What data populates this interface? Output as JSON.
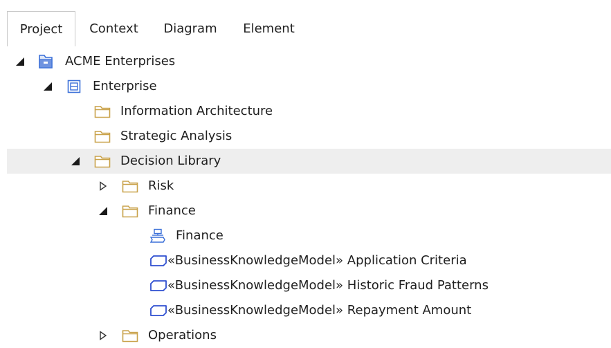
{
  "tabs": [
    {
      "label": "Project",
      "active": true
    },
    {
      "label": "Context",
      "active": false
    },
    {
      "label": "Diagram",
      "active": false
    },
    {
      "label": "Element",
      "active": false
    }
  ],
  "tree": [
    {
      "label": "ACME Enterprises",
      "icon": "root-package-icon",
      "toggle": "expanded"
    },
    {
      "label": "Enterprise",
      "icon": "package-icon",
      "toggle": "expanded"
    },
    {
      "label": "Information Architecture",
      "icon": "folder-icon",
      "toggle": "none"
    },
    {
      "label": "Strategic Analysis",
      "icon": "folder-icon",
      "toggle": "none"
    },
    {
      "label": "Decision Library",
      "icon": "folder-icon",
      "toggle": "expanded",
      "selected": true
    },
    {
      "label": "Risk",
      "icon": "folder-icon",
      "toggle": "collapsed"
    },
    {
      "label": "Finance",
      "icon": "folder-icon",
      "toggle": "expanded"
    },
    {
      "label": "Finance",
      "icon": "diagram-icon",
      "toggle": "none"
    },
    {
      "label": "«BusinessKnowledgeModel» Application Criteria",
      "icon": "business-knowledge-model-icon",
      "toggle": "none"
    },
    {
      "label": "«BusinessKnowledgeModel» Historic Fraud Patterns",
      "icon": "business-knowledge-model-icon",
      "toggle": "none"
    },
    {
      "label": "«BusinessKnowledgeModel» Repayment Amount",
      "icon": "business-knowledge-model-icon",
      "toggle": "none"
    },
    {
      "label": "Operations",
      "icon": "folder-icon",
      "toggle": "collapsed"
    }
  ],
  "colors": {
    "folder": "#c9a24a",
    "package": "#3a6fd8",
    "bkm": "#2f4fd0",
    "selected_row": "#eeeeee"
  }
}
